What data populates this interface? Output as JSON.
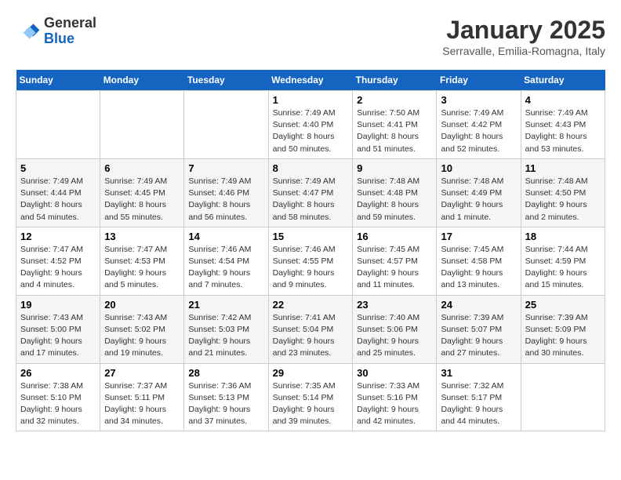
{
  "header": {
    "logo_line1": "General",
    "logo_line2": "Blue",
    "month_title": "January 2025",
    "subtitle": "Serravalle, Emilia-Romagna, Italy"
  },
  "weekdays": [
    "Sunday",
    "Monday",
    "Tuesday",
    "Wednesday",
    "Thursday",
    "Friday",
    "Saturday"
  ],
  "weeks": [
    [
      {
        "day": "",
        "info": ""
      },
      {
        "day": "",
        "info": ""
      },
      {
        "day": "",
        "info": ""
      },
      {
        "day": "1",
        "info": "Sunrise: 7:49 AM\nSunset: 4:40 PM\nDaylight: 8 hours\nand 50 minutes."
      },
      {
        "day": "2",
        "info": "Sunrise: 7:50 AM\nSunset: 4:41 PM\nDaylight: 8 hours\nand 51 minutes."
      },
      {
        "day": "3",
        "info": "Sunrise: 7:49 AM\nSunset: 4:42 PM\nDaylight: 8 hours\nand 52 minutes."
      },
      {
        "day": "4",
        "info": "Sunrise: 7:49 AM\nSunset: 4:43 PM\nDaylight: 8 hours\nand 53 minutes."
      }
    ],
    [
      {
        "day": "5",
        "info": "Sunrise: 7:49 AM\nSunset: 4:44 PM\nDaylight: 8 hours\nand 54 minutes."
      },
      {
        "day": "6",
        "info": "Sunrise: 7:49 AM\nSunset: 4:45 PM\nDaylight: 8 hours\nand 55 minutes."
      },
      {
        "day": "7",
        "info": "Sunrise: 7:49 AM\nSunset: 4:46 PM\nDaylight: 8 hours\nand 56 minutes."
      },
      {
        "day": "8",
        "info": "Sunrise: 7:49 AM\nSunset: 4:47 PM\nDaylight: 8 hours\nand 58 minutes."
      },
      {
        "day": "9",
        "info": "Sunrise: 7:48 AM\nSunset: 4:48 PM\nDaylight: 8 hours\nand 59 minutes."
      },
      {
        "day": "10",
        "info": "Sunrise: 7:48 AM\nSunset: 4:49 PM\nDaylight: 9 hours\nand 1 minute."
      },
      {
        "day": "11",
        "info": "Sunrise: 7:48 AM\nSunset: 4:50 PM\nDaylight: 9 hours\nand 2 minutes."
      }
    ],
    [
      {
        "day": "12",
        "info": "Sunrise: 7:47 AM\nSunset: 4:52 PM\nDaylight: 9 hours\nand 4 minutes."
      },
      {
        "day": "13",
        "info": "Sunrise: 7:47 AM\nSunset: 4:53 PM\nDaylight: 9 hours\nand 5 minutes."
      },
      {
        "day": "14",
        "info": "Sunrise: 7:46 AM\nSunset: 4:54 PM\nDaylight: 9 hours\nand 7 minutes."
      },
      {
        "day": "15",
        "info": "Sunrise: 7:46 AM\nSunset: 4:55 PM\nDaylight: 9 hours\nand 9 minutes."
      },
      {
        "day": "16",
        "info": "Sunrise: 7:45 AM\nSunset: 4:57 PM\nDaylight: 9 hours\nand 11 minutes."
      },
      {
        "day": "17",
        "info": "Sunrise: 7:45 AM\nSunset: 4:58 PM\nDaylight: 9 hours\nand 13 minutes."
      },
      {
        "day": "18",
        "info": "Sunrise: 7:44 AM\nSunset: 4:59 PM\nDaylight: 9 hours\nand 15 minutes."
      }
    ],
    [
      {
        "day": "19",
        "info": "Sunrise: 7:43 AM\nSunset: 5:00 PM\nDaylight: 9 hours\nand 17 minutes."
      },
      {
        "day": "20",
        "info": "Sunrise: 7:43 AM\nSunset: 5:02 PM\nDaylight: 9 hours\nand 19 minutes."
      },
      {
        "day": "21",
        "info": "Sunrise: 7:42 AM\nSunset: 5:03 PM\nDaylight: 9 hours\nand 21 minutes."
      },
      {
        "day": "22",
        "info": "Sunrise: 7:41 AM\nSunset: 5:04 PM\nDaylight: 9 hours\nand 23 minutes."
      },
      {
        "day": "23",
        "info": "Sunrise: 7:40 AM\nSunset: 5:06 PM\nDaylight: 9 hours\nand 25 minutes."
      },
      {
        "day": "24",
        "info": "Sunrise: 7:39 AM\nSunset: 5:07 PM\nDaylight: 9 hours\nand 27 minutes."
      },
      {
        "day": "25",
        "info": "Sunrise: 7:39 AM\nSunset: 5:09 PM\nDaylight: 9 hours\nand 30 minutes."
      }
    ],
    [
      {
        "day": "26",
        "info": "Sunrise: 7:38 AM\nSunset: 5:10 PM\nDaylight: 9 hours\nand 32 minutes."
      },
      {
        "day": "27",
        "info": "Sunrise: 7:37 AM\nSunset: 5:11 PM\nDaylight: 9 hours\nand 34 minutes."
      },
      {
        "day": "28",
        "info": "Sunrise: 7:36 AM\nSunset: 5:13 PM\nDaylight: 9 hours\nand 37 minutes."
      },
      {
        "day": "29",
        "info": "Sunrise: 7:35 AM\nSunset: 5:14 PM\nDaylight: 9 hours\nand 39 minutes."
      },
      {
        "day": "30",
        "info": "Sunrise: 7:33 AM\nSunset: 5:16 PM\nDaylight: 9 hours\nand 42 minutes."
      },
      {
        "day": "31",
        "info": "Sunrise: 7:32 AM\nSunset: 5:17 PM\nDaylight: 9 hours\nand 44 minutes."
      },
      {
        "day": "",
        "info": ""
      }
    ]
  ]
}
